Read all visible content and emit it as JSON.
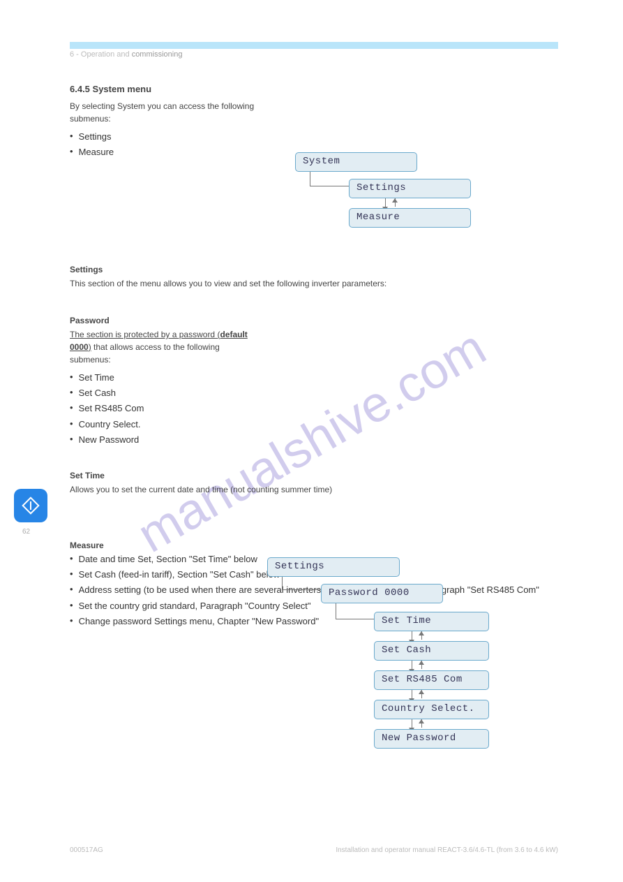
{
  "breadcrumb": {
    "prefix": "6 - Operation and",
    "current": "commissioning"
  },
  "section1": {
    "title": "6.4.5 System menu",
    "intro": "By selecting System you can access the following submenus:",
    "settings_label": "Settings",
    "measure_label": "Measure",
    "box_system": "System",
    "box_settings": "Settings",
    "box_measure": "Measure"
  },
  "section_settings": {
    "label": "Settings",
    "intro": "This section of the menu allows you to view and set the following inverter parameters:"
  },
  "pwd": {
    "label": "Password",
    "underline_note": "The section is protected by a password (default 0000) that allows access to the following submenus:",
    "items": [
      "Set Time",
      "Set Cash",
      "Set RS485 Com",
      "Country Select.",
      "New Password"
    ]
  },
  "section_settime": {
    "label": "Set Time",
    "desc": "Allows you to set the current date and time (not counting summer time)"
  },
  "section_measure": {
    "label": "Measure",
    "items": [
      "Date and time Set, Section \"Set Time\" below",
      "Set Cash (feed-in tariff), Section \"Set Cash\" below",
      "Address setting (to be used when there are several inverters on a single RS485 line), Paragraph \"Set RS485 Com\"",
      "Set the country grid standard, Paragraph \"Country Select\"",
      "Change password Settings menu, Chapter \"New Password\""
    ]
  },
  "diag2": {
    "box_settings": "Settings",
    "box_password": "Password 0000",
    "box_settime": "Set Time",
    "box_setcash": "Set Cash",
    "box_rs485": "Set RS485 Com",
    "box_country": "Country Select.",
    "box_newpwd": "New Password"
  },
  "footer": {
    "doc": "000517AG",
    "rev": "Installation and operator manual REACT-3.6/4.6-TL (from 3.6 to 4.6 kW)"
  },
  "pagenum": "62",
  "watermark": "manualshive.com"
}
